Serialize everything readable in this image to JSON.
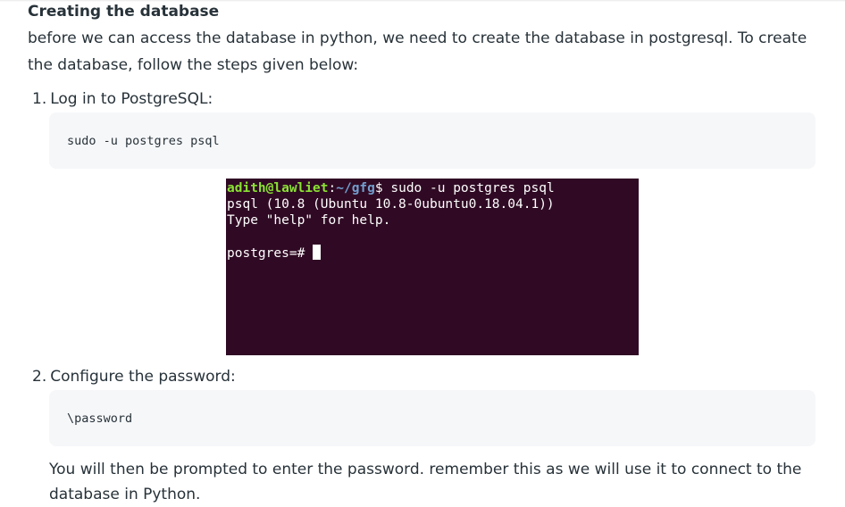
{
  "heading": "Creating the database",
  "intro": "before we can access the database in python, we need to create the database in postgresql. To create the database, follow the steps given below:",
  "steps": [
    {
      "number": "1.",
      "label": "Log in to PostgreSQL:",
      "code": "sudo -u postgres psql"
    },
    {
      "number": "2.",
      "label": "Configure the password:",
      "code": "\\password"
    }
  ],
  "terminal": {
    "user_host": "adith@lawliet",
    "separator": ":",
    "path": "~/gfg",
    "prompt_symbol": "$ ",
    "command": "sudo -u postgres psql",
    "output_line_1": "psql (10.8 (Ubuntu 10.8-0ubuntu0.18.04.1))",
    "output_line_2": "Type \"help\" for help.",
    "psql_prompt": "postgres=# ",
    "colors": {
      "background": "#300a24",
      "user_host": "#8ae234",
      "path": "#729fcf",
      "text": "#ffffff"
    }
  },
  "closing": "You will then be prompted to enter the password. remember this as we will use it to connect to the database in Python."
}
